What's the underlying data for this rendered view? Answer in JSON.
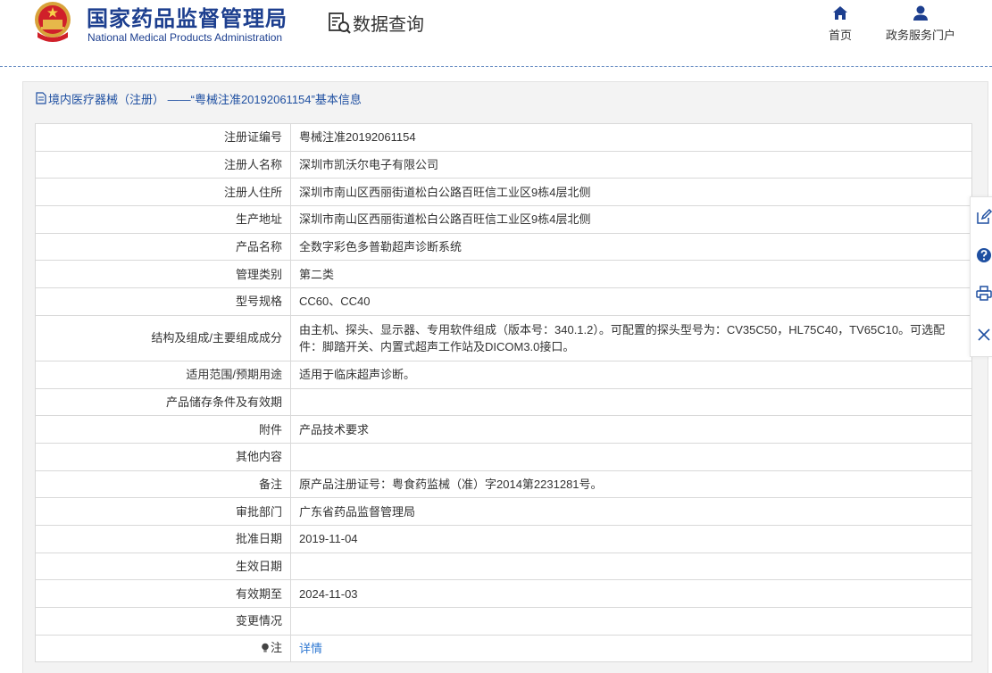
{
  "header": {
    "brand_cn": "国家药品监督管理局",
    "brand_en": "National Medical Products Administration",
    "query_label": "数据查询",
    "nav": [
      {
        "label": "首页",
        "icon": "home-icon"
      },
      {
        "label": "政务服务门户",
        "icon": "user-icon"
      }
    ]
  },
  "panel": {
    "title": "境内医疗器械（注册） ——“粤械注准20192061154”基本信息"
  },
  "rows": [
    {
      "label": "注册证编号",
      "value": "粤械注准20192061154"
    },
    {
      "label": "注册人名称",
      "value": "深圳市凯沃尔电子有限公司"
    },
    {
      "label": "注册人住所",
      "value": "深圳市南山区西丽街道松白公路百旺信工业区9栋4层北侧"
    },
    {
      "label": "生产地址",
      "value": "深圳市南山区西丽街道松白公路百旺信工业区9栋4层北侧"
    },
    {
      "label": "产品名称",
      "value": "全数字彩色多普勒超声诊断系统"
    },
    {
      "label": "管理类别",
      "value": "第二类"
    },
    {
      "label": "型号规格",
      "value": "CC60、CC40"
    },
    {
      "label": "结构及组成/主要组成成分",
      "value": "由主机、探头、显示器、专用软件组成（版本号：340.1.2）。可配置的探头型号为：CV35C50，HL75C40，TV65C10。可选配件：脚踏开关、内置式超声工作站及DICOM3.0接口。"
    },
    {
      "label": "适用范围/预期用途",
      "value": "适用于临床超声诊断。"
    },
    {
      "label": "产品储存条件及有效期",
      "value": ""
    },
    {
      "label": "附件",
      "value": "产品技术要求"
    },
    {
      "label": "其他内容",
      "value": ""
    },
    {
      "label": "备注",
      "value": "原产品注册证号：粤食药监械（准）字2014第2231281号。"
    },
    {
      "label": "审批部门",
      "value": "广东省药品监督管理局"
    },
    {
      "label": "批准日期",
      "value": "2019-11-04"
    },
    {
      "label": "生效日期",
      "value": ""
    },
    {
      "label": "有效期至",
      "value": "2024-11-03"
    },
    {
      "label": "变更情况",
      "value": ""
    }
  ],
  "note_row": {
    "label": "注",
    "value": "详情"
  },
  "sidebar": [
    "edit-icon",
    "help-icon",
    "print-icon",
    "close-icon"
  ],
  "colors": {
    "brand": "#1d3f8f",
    "link": "#2f78d2",
    "panel_bg": "#f3f3f3",
    "border": "#d9d9d9"
  }
}
